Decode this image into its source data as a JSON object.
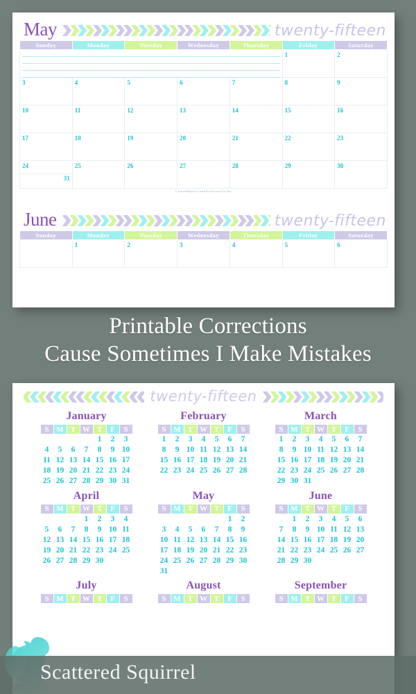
{
  "background_color": "#737f7a",
  "palette": {
    "lavender": "#cfc9e8",
    "cyan": "#9ef0ee",
    "green": "#d3f59a",
    "date_teal": "#1ec3cf",
    "title_purple": "#8b52b5",
    "year_word": "#cfc8ea",
    "grid_line": "#e9eef0",
    "notes_line": "#b8ecee"
  },
  "headline": {
    "line1": "Printable Corrections",
    "line2": "Cause Sometimes I Make Mistakes"
  },
  "brand": {
    "name": "Scattered Squirrel",
    "logo_icon": "squirrel-icon"
  },
  "monthly_page": {
    "year_word": "twenty-fifteen",
    "weekday_headers": [
      "Sunday",
      "Monday",
      "Tuesday",
      "Wednesday",
      "Thursday",
      "Friday",
      "Saturday"
    ],
    "header_colors": [
      "#cfc9e8",
      "#9ef0ee",
      "#d3f59a",
      "#cfc9e8",
      "#d3f59a",
      "#9ef0ee",
      "#cfc9e8"
    ],
    "footer_credit": "© ScatteredSquirrel.com",
    "footer_heart": "♥",
    "footer_rights": "For Personal Use Only",
    "months": [
      {
        "name": "May",
        "weeks": [
          [
            "",
            "",
            "",
            "",
            "",
            "1",
            "2"
          ],
          [
            "3",
            "4",
            "5",
            "6",
            "7",
            "8",
            "9"
          ],
          [
            "10",
            "11",
            "12",
            "13",
            "14",
            "15",
            "16"
          ],
          [
            "17",
            "18",
            "19",
            "20",
            "21",
            "22",
            "23"
          ],
          [
            "24",
            "25",
            "26",
            "27",
            "28",
            "29",
            "30"
          ]
        ],
        "split_cell": {
          "top": "24",
          "bottom": "31"
        },
        "notes_row_span": 5,
        "notes_line_count": 4
      },
      {
        "name": "June",
        "weeks": [
          [
            "",
            "1",
            "2",
            "3",
            "4",
            "5",
            "6"
          ]
        ]
      }
    ]
  },
  "year_page": {
    "year_word": "twenty-fifteen",
    "dow_headers": [
      "S",
      "M",
      "T",
      "W",
      "T",
      "F",
      "S"
    ],
    "header_colors": [
      "#cfc9e8",
      "#9ef0ee",
      "#d3f59a",
      "#cfc9e8",
      "#d3f59a",
      "#9ef0ee",
      "#cfc9e8"
    ],
    "months": [
      {
        "name": "January",
        "weeks": [
          [
            "",
            "",
            "",
            "",
            "1",
            "2",
            "3"
          ],
          [
            "4",
            "5",
            "6",
            "7",
            "8",
            "9",
            "10"
          ],
          [
            "11",
            "12",
            "13",
            "14",
            "15",
            "16",
            "17"
          ],
          [
            "18",
            "19",
            "20",
            "21",
            "22",
            "23",
            "24"
          ],
          [
            "25",
            "26",
            "27",
            "28",
            "29",
            "30",
            "31"
          ]
        ]
      },
      {
        "name": "February",
        "weeks": [
          [
            "1",
            "2",
            "3",
            "4",
            "5",
            "6",
            "7"
          ],
          [
            "8",
            "9",
            "10",
            "11",
            "12",
            "13",
            "14"
          ],
          [
            "15",
            "16",
            "17",
            "18",
            "19",
            "20",
            "21"
          ],
          [
            "22",
            "23",
            "24",
            "25",
            "26",
            "27",
            "28"
          ]
        ]
      },
      {
        "name": "March",
        "weeks": [
          [
            "1",
            "2",
            "3",
            "4",
            "5",
            "6",
            "7"
          ],
          [
            "8",
            "9",
            "10",
            "11",
            "12",
            "13",
            "14"
          ],
          [
            "15",
            "16",
            "17",
            "18",
            "19",
            "20",
            "21"
          ],
          [
            "22",
            "23",
            "24",
            "25",
            "26",
            "27",
            "28"
          ],
          [
            "29",
            "30",
            "31",
            "",
            "",
            "",
            ""
          ]
        ]
      },
      {
        "name": "April",
        "weeks": [
          [
            "",
            "",
            "",
            "1",
            "2",
            "3",
            "4"
          ],
          [
            "5",
            "6",
            "7",
            "8",
            "9",
            "10",
            "11"
          ],
          [
            "12",
            "13",
            "14",
            "15",
            "16",
            "17",
            "18"
          ],
          [
            "19",
            "20",
            "21",
            "22",
            "23",
            "24",
            "25"
          ],
          [
            "26",
            "27",
            "28",
            "29",
            "30",
            "",
            ""
          ]
        ]
      },
      {
        "name": "May",
        "weeks": [
          [
            "",
            "",
            "",
            "",
            "",
            "1",
            "2"
          ],
          [
            "3",
            "4",
            "5",
            "6",
            "7",
            "8",
            "9"
          ],
          [
            "10",
            "11",
            "12",
            "13",
            "14",
            "15",
            "16"
          ],
          [
            "17",
            "18",
            "19",
            "20",
            "21",
            "22",
            "23"
          ],
          [
            "24",
            "25",
            "26",
            "27",
            "28",
            "29",
            "30"
          ],
          [
            "31",
            "",
            "",
            "",
            "",
            "",
            ""
          ]
        ]
      },
      {
        "name": "June",
        "weeks": [
          [
            "",
            "1",
            "2",
            "3",
            "4",
            "5",
            "6"
          ],
          [
            "7",
            "8",
            "9",
            "10",
            "11",
            "12",
            "13"
          ],
          [
            "14",
            "15",
            "16",
            "17",
            "18",
            "19",
            "20"
          ],
          [
            "21",
            "22",
            "23",
            "24",
            "25",
            "26",
            "27"
          ],
          [
            "28",
            "29",
            "30",
            "",
            "",
            "",
            ""
          ]
        ]
      },
      {
        "name": "July",
        "weeks": []
      },
      {
        "name": "August",
        "weeks": []
      },
      {
        "name": "September",
        "weeks": []
      }
    ]
  }
}
